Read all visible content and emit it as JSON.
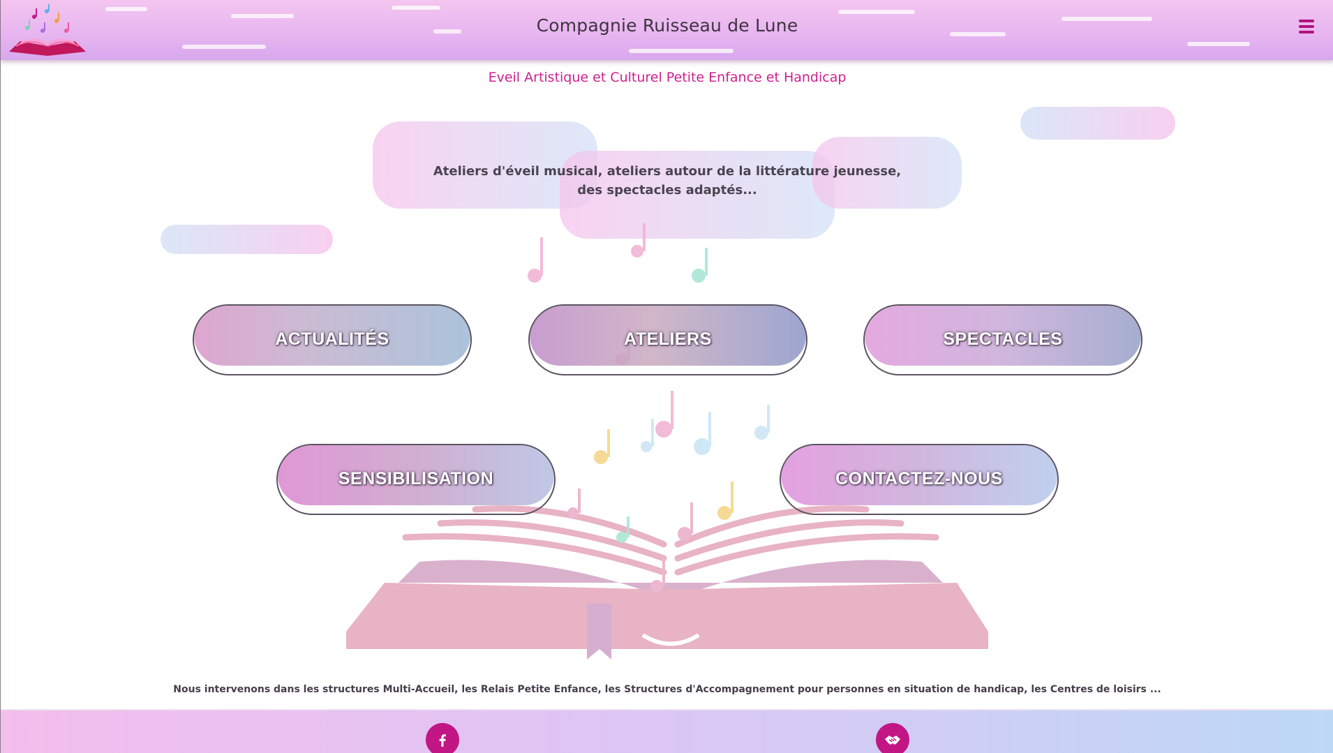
{
  "header": {
    "title": "Compagnie Ruisseau de Lune",
    "logo_icon": "open-book-music-logo",
    "menu_icon": "hamburger-menu-icon"
  },
  "subtitle": "Eveil Artistique et Culturel Petite Enfance et Handicap",
  "intro": {
    "line1": "Ateliers d'éveil musical, ateliers autour de la littérature jeunesse,",
    "line2": "des spectacles adaptés..."
  },
  "nav": {
    "actualites": "ACTUALITÉS",
    "ateliers": "ATELIERS",
    "spectacles": "SPECTACLES",
    "sensibilisation": "SENSIBILISATION",
    "contact": "CONTACTEZ-NOUS"
  },
  "footer_text": "Nous intervenons dans les structures Multi-Accueil, les Relais Petite Enfance, les Structures d'Accompagnement pour personnes en situation de handicap, les Centres de loisirs ...",
  "footer": {
    "facebook_icon": "facebook-icon",
    "partner_icon": "handshake-icon"
  },
  "colors": {
    "accent": "#c21684",
    "subtitle": "#cf1f8e",
    "header_pink": "#e8b6f0",
    "book_pink": "#e8b3c4"
  }
}
